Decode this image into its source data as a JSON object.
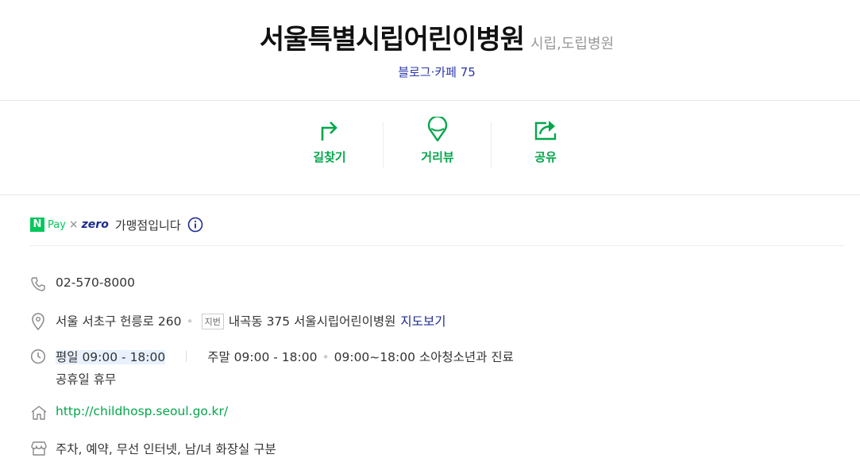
{
  "header": {
    "title": "서울특별시립어린이병원",
    "category": "시립,도립병원",
    "review_link": "블로그·카페 75"
  },
  "actions": [
    {
      "label": "길찾기",
      "icon": "directions-icon"
    },
    {
      "label": "거리뷰",
      "icon": "street-view-icon"
    },
    {
      "label": "공유",
      "icon": "share-icon"
    }
  ],
  "pay": {
    "n_letter": "N",
    "pay": "Pay",
    "times": "×",
    "zero": "zero",
    "text": "가맹점입니다"
  },
  "info": {
    "phone": "02-570-8000",
    "address": {
      "road": "서울 서초구 헌릉로 260",
      "lot_badge": "지번",
      "lot": "내곡동 375 서울시립어린이병원",
      "map_link": "지도보기"
    },
    "hours": {
      "weekday": "평일 09:00 - 18:00",
      "weekend": "주말 09:00 - 18:00",
      "youth": "09:00~18:00 소아청소년과 진료",
      "holiday": "공휴일 휴무"
    },
    "homepage": "http://childhosp.seoul.go.kr/",
    "facilities": "주차, 예약, 무선 인터넷, 남/녀 화장실 구분"
  },
  "colors": {
    "accent_green": "#03a64b",
    "link_blue": "#1b2a8f",
    "npay_green": "#03c75a"
  }
}
